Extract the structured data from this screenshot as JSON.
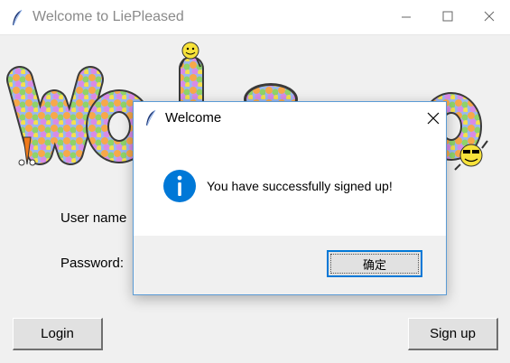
{
  "window": {
    "title": "Welcome to LiePleased",
    "icon": "feather-icon",
    "controls": [
      "minimize-icon",
      "maximize-icon",
      "close-icon"
    ]
  },
  "banner": {
    "image": "welcome-smiley-banner"
  },
  "form": {
    "username_label": "User name",
    "password_label": "Password:"
  },
  "buttons": {
    "login": "Login",
    "signup": "Sign up"
  },
  "dialog": {
    "title": "Welcome",
    "icon": "info-icon",
    "message": "You have successfully signed up!",
    "ok_label": "确定"
  },
  "colors": {
    "dialog_border": "#5b9bd5",
    "info_blue": "#0078d7",
    "focus_border": "#0078d7"
  }
}
